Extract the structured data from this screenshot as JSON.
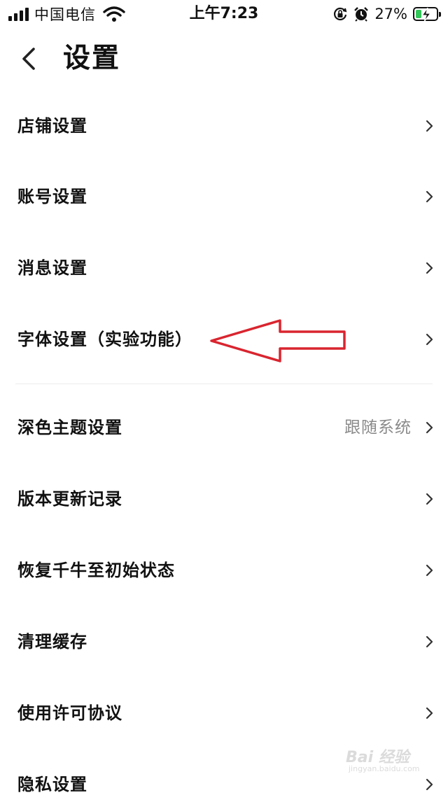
{
  "status_bar": {
    "carrier": "中国电信",
    "time": "上午7:23",
    "battery_percent": "27%",
    "battery_level": 0.27,
    "signal_bars": 4,
    "icons": [
      "signal-icon",
      "wifi-icon",
      "orientation-lock-icon",
      "alarm-icon",
      "battery-charging-icon"
    ]
  },
  "nav": {
    "title": "设置",
    "back_icon": "chevron-left-icon"
  },
  "settings": {
    "group1": [
      {
        "label": "店铺设置"
      },
      {
        "label": "账号设置"
      },
      {
        "label": "消息设置"
      },
      {
        "label": "字体设置（实验功能）"
      }
    ],
    "group2": [
      {
        "label": "深色主题设置",
        "value": "跟随系统"
      },
      {
        "label": "版本更新记录"
      },
      {
        "label": "恢复千牛至初始状态"
      },
      {
        "label": "清理缓存"
      },
      {
        "label": "使用许可协议"
      },
      {
        "label": "隐私设置"
      }
    ]
  },
  "annotation": {
    "color": "#d9252f",
    "icon": "left-arrow-annotation"
  },
  "watermark": {
    "main": "Bai 经验",
    "sub": "jingyan.baidu.com"
  }
}
